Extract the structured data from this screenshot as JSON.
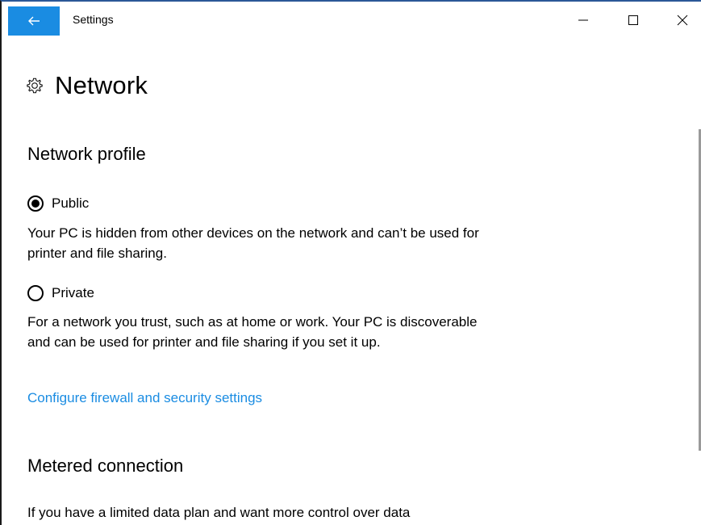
{
  "titlebar": {
    "back_icon": "back-arrow-icon",
    "app_title": "Settings",
    "controls": [
      "minimize",
      "maximize",
      "close"
    ]
  },
  "header": {
    "icon": "gear-icon",
    "title": "Network"
  },
  "network_profile": {
    "heading": "Network profile",
    "options": [
      {
        "label": "Public",
        "checked": true,
        "description": "Your PC is hidden from other devices on the network and can’t be used for printer and file sharing."
      },
      {
        "label": "Private",
        "checked": false,
        "description": "For a network you trust, such as at home or work. Your PC is discoverable and can be used for printer and file sharing if you set it up."
      }
    ],
    "link": "Configure firewall and security settings"
  },
  "metered": {
    "heading": "Metered connection",
    "description": "If you have a limited data plan and want more control over data"
  },
  "colors": {
    "accent": "#1a8ce2",
    "text": "#000000",
    "background": "#ffffff"
  }
}
